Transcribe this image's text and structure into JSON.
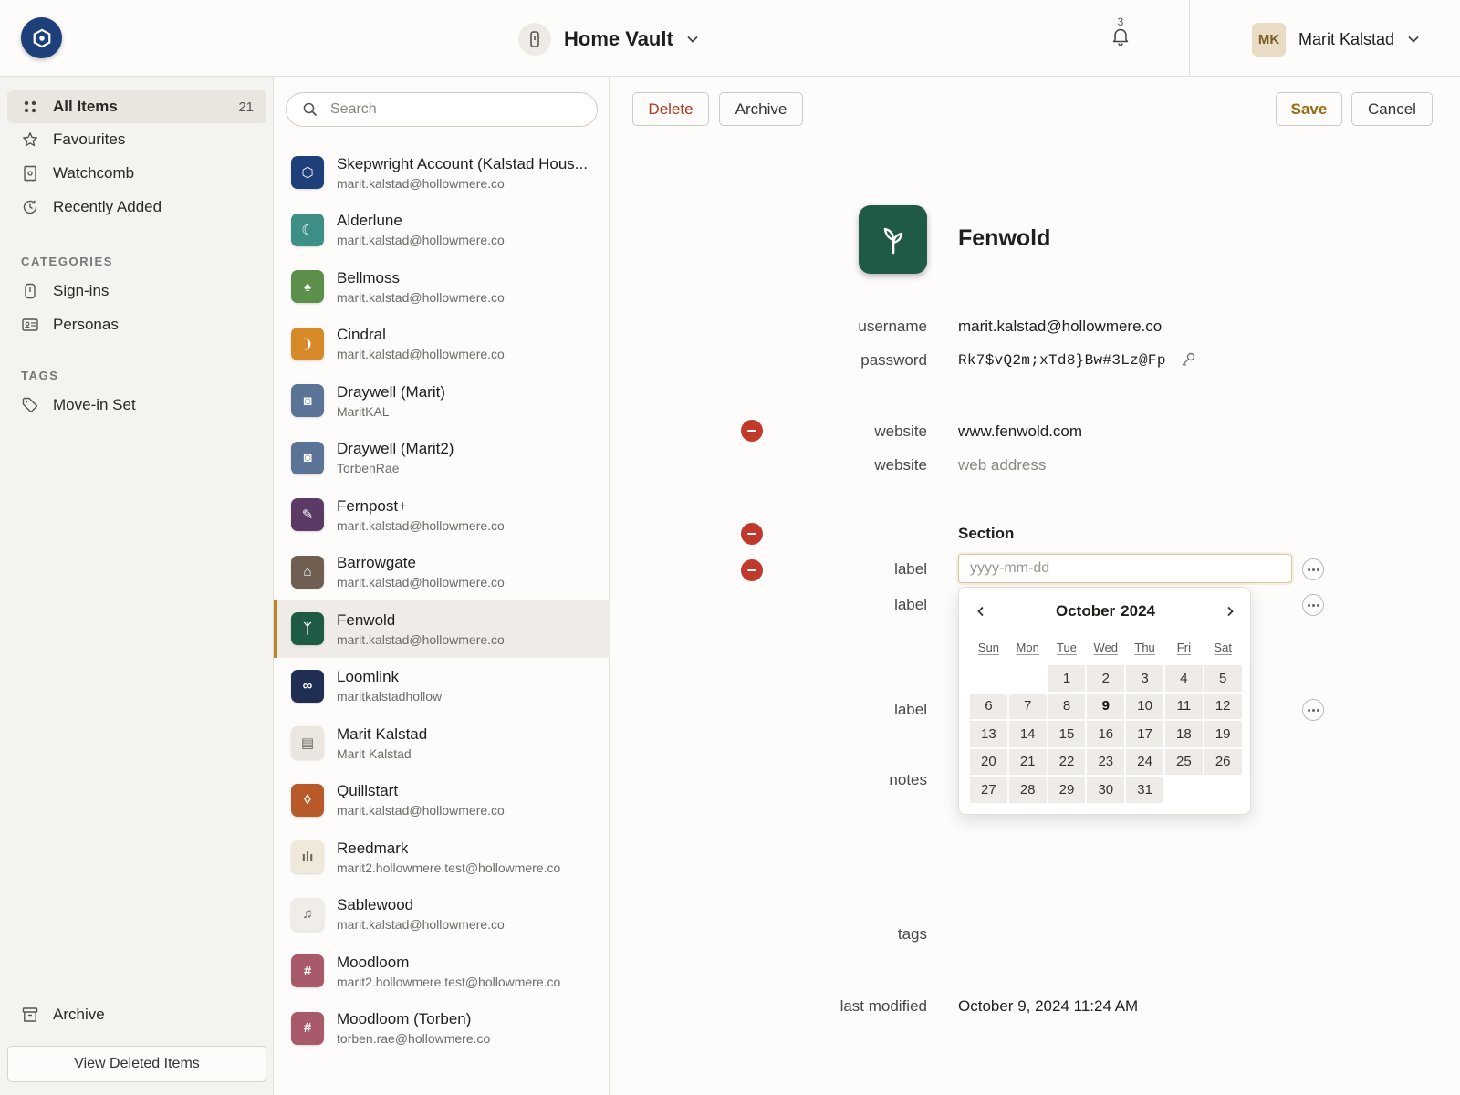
{
  "topbar": {
    "vault_name": "Home Vault",
    "notification_count": "3",
    "account_initials": "MK",
    "account_name": "Marit Kalstad"
  },
  "sidebar": {
    "nav": [
      {
        "label": "All Items",
        "count": "21",
        "icon": "grid-icon"
      },
      {
        "label": "Favourites",
        "icon": "star-icon"
      },
      {
        "label": "Watchcomb",
        "icon": "vault-icon"
      },
      {
        "label": "Recently Added",
        "icon": "clock-icon"
      }
    ],
    "categories_heading": "CATEGORIES",
    "categories": [
      {
        "label": "Sign-ins",
        "icon": "key-tag-icon"
      },
      {
        "label": "Personas",
        "icon": "id-card-icon"
      }
    ],
    "tags_heading": "TAGS",
    "tags": [
      {
        "label": "Move-in Set",
        "icon": "tag-icon"
      }
    ],
    "archive_label": "Archive",
    "view_deleted_label": "View Deleted Items"
  },
  "list": {
    "search_placeholder": "Search",
    "items": [
      {
        "title": "Skepwright Account (Kalstad Hous...",
        "subtitle": "marit.kalstad@hollowmere.co",
        "color": "#1d3f7a",
        "glyph": "⬡"
      },
      {
        "title": "Alderlune",
        "subtitle": "marit.kalstad@hollowmere.co",
        "color": "#3e8f86",
        "glyph": "☾"
      },
      {
        "title": "Bellmoss",
        "subtitle": "marit.kalstad@hollowmere.co",
        "color": "#5c8f4a",
        "glyph": "♠"
      },
      {
        "title": "Cindral",
        "subtitle": "marit.kalstad@hollowmere.co",
        "color": "#d68a2a",
        "glyph": "❩"
      },
      {
        "title": "Draywell (Marit)",
        "subtitle": "MaritKAL",
        "color": "#5a7396",
        "glyph": "◙"
      },
      {
        "title": "Draywell (Marit2)",
        "subtitle": "TorbenRae",
        "color": "#5a7396",
        "glyph": "◙"
      },
      {
        "title": "Fernpost+",
        "subtitle": "marit.kalstad@hollowmere.co",
        "color": "#5c3a66",
        "glyph": "✎"
      },
      {
        "title": "Barrowgate",
        "subtitle": "marit.kalstad@hollowmere.co",
        "color": "#6e5f52",
        "glyph": "⌂"
      },
      {
        "title": "Fenwold",
        "subtitle": "marit.kalstad@hollowmere.co",
        "color": "#1f5a45",
        "glyph": "ᛉ",
        "selected": true
      },
      {
        "title": "Loomlink",
        "subtitle": "maritkalstadhollow",
        "color": "#1f2e52",
        "glyph": "∞"
      },
      {
        "title": "Marit Kalstad",
        "subtitle": "Marit Kalstad",
        "color": "#ebe7e0",
        "glyph": "▤",
        "dark_glyph": true
      },
      {
        "title": "Quillstart",
        "subtitle": "marit.kalstad@hollowmere.co",
        "color": "#b85a2a",
        "glyph": "◊"
      },
      {
        "title": "Reedmark",
        "subtitle": "marit2.hollowmere.test@hollowmere.co",
        "color": "#f0e8d8",
        "glyph": "ılı",
        "dark_glyph": true
      },
      {
        "title": "Sablewood",
        "subtitle": "marit.kalstad@hollowmere.co",
        "color": "#f0ede8",
        "glyph": "♫",
        "dark_glyph": true
      },
      {
        "title": "Moodloom",
        "subtitle": "marit2.hollowmere.test@hollowmere.co",
        "color": "#a85a6a",
        "glyph": "#"
      },
      {
        "title": "Moodloom (Torben)",
        "subtitle": "torben.rae@hollowmere.co",
        "color": "#a85a6a",
        "glyph": "#"
      }
    ]
  },
  "detail": {
    "toolbar": {
      "delete": "Delete",
      "archive": "Archive",
      "save": "Save",
      "cancel": "Cancel"
    },
    "title": "Fenwold",
    "fields": {
      "username_label": "username",
      "username_value": "marit.kalstad@hollowmere.co",
      "password_label": "password",
      "password_value": "Rk7$vQ2m;xTd8}Bw#3Lz@Fp",
      "website_label": "website",
      "website_value": "www.fenwold.com",
      "website2_label": "website",
      "website2_placeholder": "web address",
      "section_title": "Section",
      "label1": "label",
      "date_placeholder": "yyyy-mm-dd",
      "label2": "label",
      "label3": "label",
      "notes_label": "notes",
      "tags_label": "tags",
      "last_modified_label": "last modified",
      "last_modified_value": "October 9, 2024 11:24 AM"
    },
    "calendar": {
      "month": "October",
      "year": "2024",
      "weekdays": [
        "Sun",
        "Mon",
        "Tue",
        "Wed",
        "Thu",
        "Fri",
        "Sat"
      ],
      "first_weekday": 2,
      "days_in_month": 31,
      "today": 9
    }
  },
  "colors": {
    "brand": "#1d3f7a",
    "accent_gold": "#b8862a",
    "danger": "#c0392b"
  }
}
